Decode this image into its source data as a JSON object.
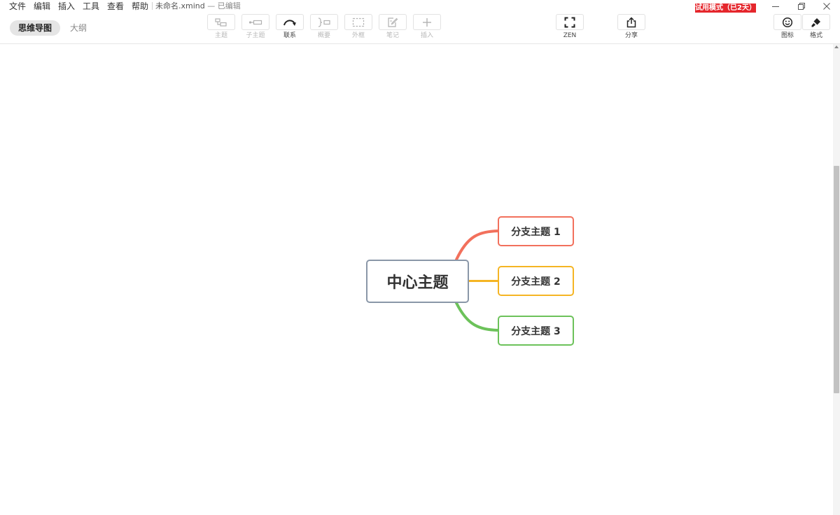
{
  "menu": [
    "文件",
    "编辑",
    "插入",
    "工具",
    "查看",
    "帮助"
  ],
  "document": {
    "name": "未命名.xmind",
    "status": "— 已编辑"
  },
  "trial_badge": "试用模式（已2天）",
  "views": {
    "mindmap": "思维导图",
    "outline": "大纲"
  },
  "toolbar": {
    "topic": "主题",
    "subtopic": "子主题",
    "relationship": "联系",
    "summary": "概要",
    "boundary": "外框",
    "note": "笔记",
    "insert": "插入",
    "zen": "ZEN",
    "share": "分享",
    "icons": "图标",
    "format": "格式"
  },
  "mindmap": {
    "central": "中心主题",
    "branches": [
      {
        "label": "分支主题 1",
        "color": "#f2705c"
      },
      {
        "label": "分支主题 2",
        "color": "#f5b524"
      },
      {
        "label": "分支主题 3",
        "color": "#6cc25a"
      }
    ]
  },
  "colors": {
    "badge": "#e5262c",
    "central_border": "#8a97a8"
  }
}
